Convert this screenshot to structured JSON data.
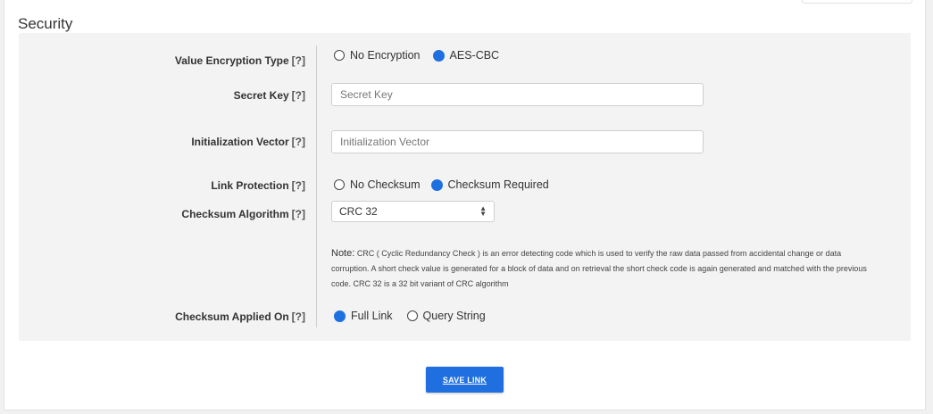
{
  "section": {
    "title": "Security"
  },
  "help_marker": "[?]",
  "encryption": {
    "label": "Value Encryption Type",
    "options": [
      {
        "label": "No Encryption",
        "selected": false
      },
      {
        "label": "AES-CBC",
        "selected": true
      }
    ]
  },
  "secret_key": {
    "label": "Secret Key",
    "placeholder": "Secret Key",
    "value": ""
  },
  "init_vector": {
    "label": "Initialization Vector",
    "placeholder": "Initialization Vector",
    "value": ""
  },
  "link_protection": {
    "label": "Link Protection",
    "options": [
      {
        "label": "No Checksum",
        "selected": false
      },
      {
        "label": "Checksum Required",
        "selected": true
      }
    ]
  },
  "checksum_algorithm": {
    "label": "Checksum Algorithm",
    "selected": "CRC 32"
  },
  "note": {
    "label": "Note:",
    "text": "CRC ( Cyclic Redundancy Check ) is an error detecting code which is used to verify the raw data passed from accidental change or data corruption. A short check value is generated for a block of data and on retrieval the short check code is again generated and matched with the previous code. CRC 32 is a 32 bit variant of CRC algorithm"
  },
  "checksum_applied": {
    "label": "Checksum Applied On",
    "options": [
      {
        "label": "Full Link",
        "selected": true
      },
      {
        "label": "Query String",
        "selected": false
      }
    ]
  },
  "save_button": {
    "label": "SAVE LINK"
  },
  "colors": {
    "accent": "#1f6fe0",
    "panel": "#f3f3f3"
  }
}
